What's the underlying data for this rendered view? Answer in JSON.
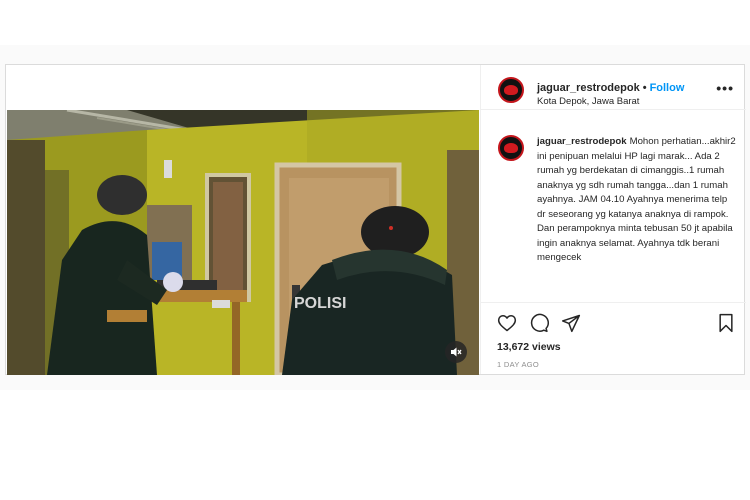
{
  "post": {
    "username": "jaguar_restrodepok",
    "separator": "•",
    "follow_label": "Follow",
    "location": "Kota Depok, Jawa Barat",
    "more_label": "•••",
    "caption_user": "jaguar_restrodepok",
    "caption_text": "Mohon perhatian...akhir2 ini penipuan melalui HP lagi marak... Ada 2 rumah yg berdekatan di cimanggis..1 rumah anaknya yg sdh rumah tangga...dan 1 rumah ayahnya. JAM 04.10 Ayahnya menerima telp dr seseorang yg katanya anaknya di rampok. Dan perampoknya minta tebusan 50 jt apabila ingin anaknya selamat. Ayahnya tdk berani mengecek",
    "views": "13,672 views",
    "time_ago": "1 DAY AGO"
  },
  "video": {
    "vest_text": "POLISI"
  },
  "icons": {
    "mute": "speaker-muted-icon",
    "like": "heart-icon",
    "comment": "comment-bubble-icon",
    "share": "paper-plane-icon",
    "save": "bookmark-icon"
  },
  "colors": {
    "link_blue": "#0095f6",
    "avatar_red": "#c4161c",
    "text": "#262626",
    "muted": "#8e8e8e"
  }
}
